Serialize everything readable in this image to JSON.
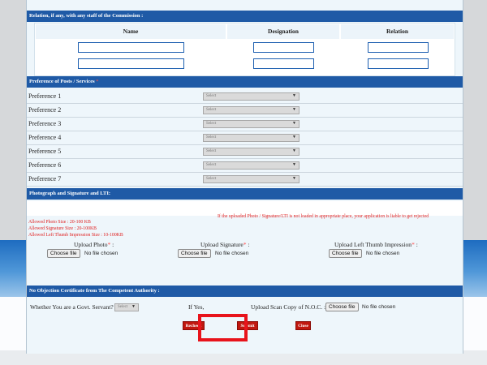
{
  "relation": {
    "header": "Relation, if any, with any staff of the Commission :",
    "columns": [
      "Name",
      "Designation",
      "Relation"
    ],
    "rows": 2
  },
  "preferences": {
    "header": "Preference of Posts / Services",
    "required_mark": "*",
    "items": [
      {
        "label": "Preference 1",
        "value": "Select"
      },
      {
        "label": "Preference 2",
        "value": "Select"
      },
      {
        "label": "Preference 3",
        "value": "Select"
      },
      {
        "label": "Preference 4",
        "value": "Select"
      },
      {
        "label": "Preference 5",
        "value": "Select"
      },
      {
        "label": "Preference 6",
        "value": "Select"
      },
      {
        "label": "Preference 7",
        "value": "Select"
      }
    ]
  },
  "photo": {
    "header": "Photograph and Signature and LTI:",
    "warning": "If the uploaded Photo / Signature/LTI is not loaded in appropriate place, your application is liable to get rejected",
    "sizes": [
      "Allowed Photo Size : 20-100 KB",
      "Allowed Signature Size : 20-100KB",
      "Allowed Left Thumb Impression Size : 10-100KB"
    ],
    "uploads": [
      {
        "label": "Upload Photo",
        "button": "Choose file",
        "status": "No file chosen"
      },
      {
        "label": "Upload Signature",
        "button": "Choose file",
        "status": "No file chosen"
      },
      {
        "label": "Upload Left Thumb Impression",
        "button": "Choose file",
        "status": "No file chosen"
      }
    ],
    "required_mark": "*",
    "colon": ":"
  },
  "noc": {
    "header": "No Objection Certificate from The Competent Authority :",
    "govt_label": "Whether You are a Govt. Servant?",
    "govt_value": "Select",
    "if_yes": "If Yes,",
    "upload_label": "Upload Scan Copy of N.O.C. :",
    "button": "Choose file",
    "status": "No file chosen"
  },
  "actions": {
    "recheck": "Recheck",
    "submit": "Submit",
    "close": "Close"
  },
  "colors": {
    "header_blue": "#1f5aa6",
    "button_red": "#c0170f",
    "highlight_red": "#e8131b"
  }
}
